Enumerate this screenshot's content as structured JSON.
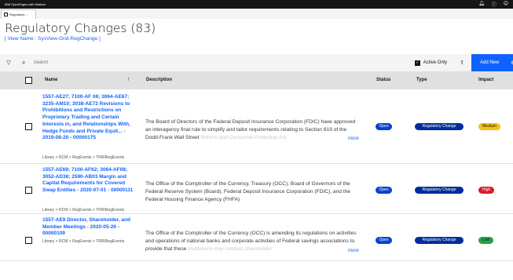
{
  "app": {
    "brand": "IBM OpenPages with Watson"
  },
  "topbar_icons": [
    "bell-icon",
    "help-icon",
    "user-icon"
  ],
  "tabs": [
    {
      "label": "Regulatory ..."
    }
  ],
  "header": {
    "title": "Regulatory Changes (83)",
    "view_name": "[ View Name : SysView-Grid-RegChange ]"
  },
  "toolbar": {
    "search_placeholder": "Search",
    "active_only_label": "Active Only",
    "active_only_checked": true,
    "add_new_label": "Add New"
  },
  "table": {
    "columns": {
      "name": "Name",
      "description": "Description",
      "status": "Status",
      "type": "Type",
      "impact": "Impact"
    },
    "rows": [
      {
        "name": "1557-AE27; 7100-AF 06; 3064-AE67; 3235-AM10; 3038-AE72 Revisions to Prohibitions and Restrictions on Proprietary Trading and Certain Interests in, and Relationships With, Hedge Funds and Private Equit... - 2019-08-20 - 00000175",
        "path": "Library > RCM > RegEvents > TRRIRegEvents",
        "description": "The Board of Directors of the Federal Deposit Insurance Corporation (FDIC) have approved an interagency final rule to simplify and tailor requirements relating to Section 619 of the Dodd-Frank Wall Street",
        "description_fade": " Reform and Consumer Protection Act",
        "more": "more",
        "status": "Open",
        "type": "Regulatory Change",
        "impact": "Medium",
        "impact_color": "#f1c21b",
        "impact_text_color": "#161616"
      },
      {
        "name": "1557-AE69; 7100-AF62; 3064-AF08; 3052-AD38; 2590-AB03 Margin and Capital Requirements for Covered Swap Entities - 2020-07-01 - 00000111",
        "path": "Library > RCM > RegEvents > TRRIRegEvents",
        "description": "The Office of the Comptroller of the Currency, Treasury (OCC), Board of Governors of the Federal Reserve System (Board), Federal Deposit Insurance Corporation (FDIC), and the Federal Housing Finance Agency (FHFA)",
        "description_fade": "",
        "more": "",
        "status": "Open",
        "type": "Regulatory Change",
        "impact": "High",
        "impact_color": "#da1e28",
        "impact_text_color": "#ffffff"
      },
      {
        "name": "1557-AE9 Director, Shareholder, and Member Meetings - 2020-05-26 - 00000109",
        "path": "Library > RCM > RegEvents > TRRIRegEvents",
        "description": "The Office of the Comptroller of the Currency (OCC) is amending its regulations on activities and operations of national banks and corporate activities of Federal savings associations to provide that these",
        "description_fade": " institutions may conduct shareholder",
        "more": "more",
        "status": "Open",
        "type": "Regulatory Change",
        "impact": "Low",
        "impact_color": "#24a148",
        "impact_text_color": "#161616"
      }
    ]
  }
}
